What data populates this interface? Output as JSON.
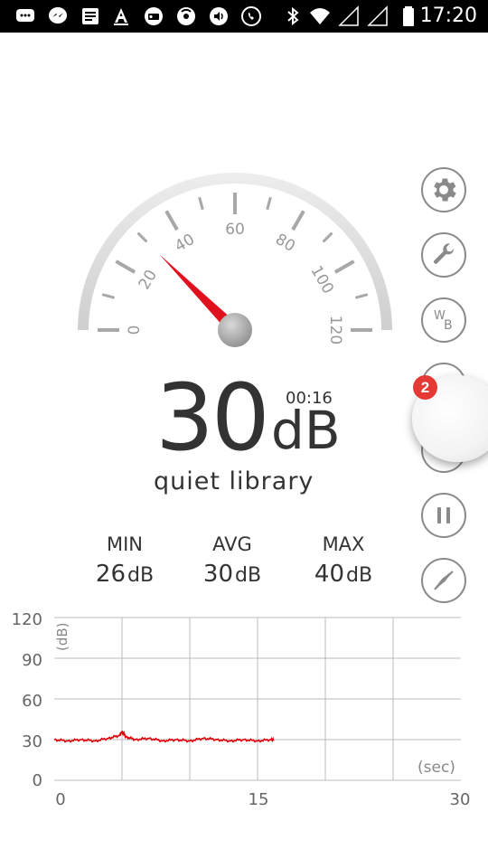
{
  "status_bar": {
    "time": "17:20",
    "icons": [
      "chat-icon",
      "messenger-icon",
      "news-icon",
      "font-icon",
      "radio-icon",
      "signal-app-icon",
      "audio-icon",
      "whatsapp-icon",
      "bluetooth-icon",
      "wifi-icon",
      "cell-signal-icon",
      "cell-signal-icon",
      "battery-icon"
    ]
  },
  "gauge": {
    "labels": [
      "0",
      "20",
      "40",
      "60",
      "80",
      "100",
      "120"
    ],
    "min": 0,
    "max": 120,
    "needle_value": 30
  },
  "reading": {
    "value": "30",
    "unit": "dB",
    "timer": "00:16",
    "description": "quiet library"
  },
  "stats": {
    "min_label": "MIN",
    "min_value": "26",
    "min_unit": "dB",
    "avg_label": "AVG",
    "avg_value": "30",
    "avg_unit": "dB",
    "max_label": "MAX",
    "max_value": "40",
    "max_unit": "dB"
  },
  "buttons": {
    "settings": "gear-icon",
    "tools": "wrench-icon",
    "weighting": "W B",
    "pause": "pause-icon",
    "compass": "compass-icon"
  },
  "bubble": {
    "badge": "2"
  },
  "graph": {
    "y_unit": "(dB)",
    "x_unit": "(sec)",
    "y_ticks": [
      "120",
      "90",
      "60",
      "30",
      "0"
    ],
    "x_ticks": [
      "0",
      "15",
      "30"
    ]
  },
  "chart_data": {
    "type": "line",
    "ylabel": "(dB)",
    "xlabel": "(sec)",
    "xlim": [
      0,
      30
    ],
    "ylim": [
      0,
      120
    ],
    "series": [
      {
        "x": [
          0,
          1,
          2,
          3,
          4,
          4.8,
          5,
          5.3,
          6,
          7,
          8,
          9,
          10,
          11,
          12,
          13,
          14,
          15,
          16,
          16.2
        ],
        "y": [
          30,
          29,
          30,
          29,
          31,
          33,
          36,
          32,
          30,
          31,
          29,
          30,
          29,
          31,
          30,
          29,
          30,
          29,
          30,
          30
        ],
        "color": "#e0000a"
      }
    ]
  }
}
